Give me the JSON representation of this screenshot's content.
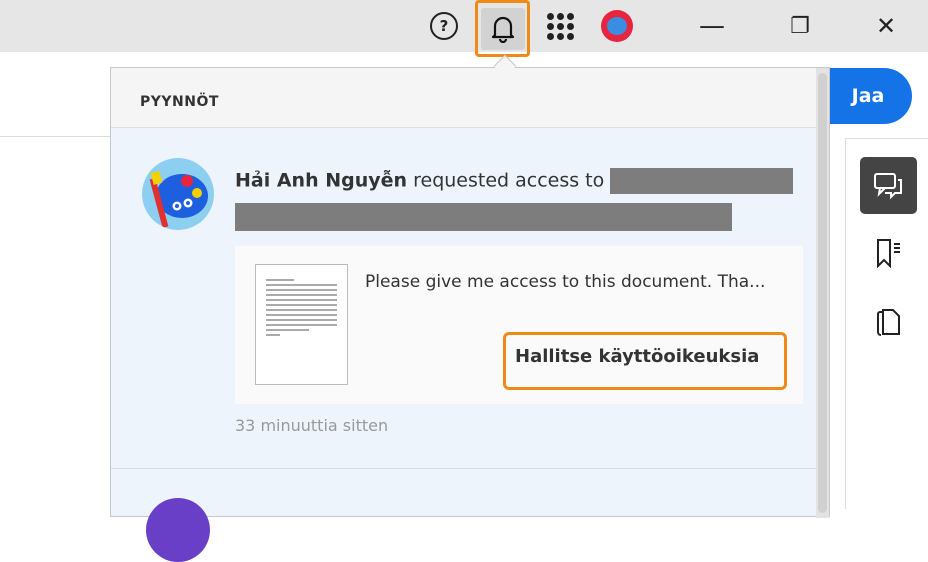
{
  "topbar": {
    "help_label": "?",
    "minimize_label": "—",
    "restore_label": "❐",
    "close_label": "✕"
  },
  "share_button": "Jaa",
  "notifications": {
    "header": "PYYNNÖT",
    "items": [
      {
        "user": "Hải Anh Nguyễn",
        "action": "requested access to",
        "message": "Please give me access to this document. Tha...",
        "manage_button": "Hallitse käyttöoikeuksia",
        "time": "33 minuuttia sitten"
      }
    ]
  },
  "colors": {
    "accent": "#1473e6",
    "highlight": "#f08a17"
  }
}
